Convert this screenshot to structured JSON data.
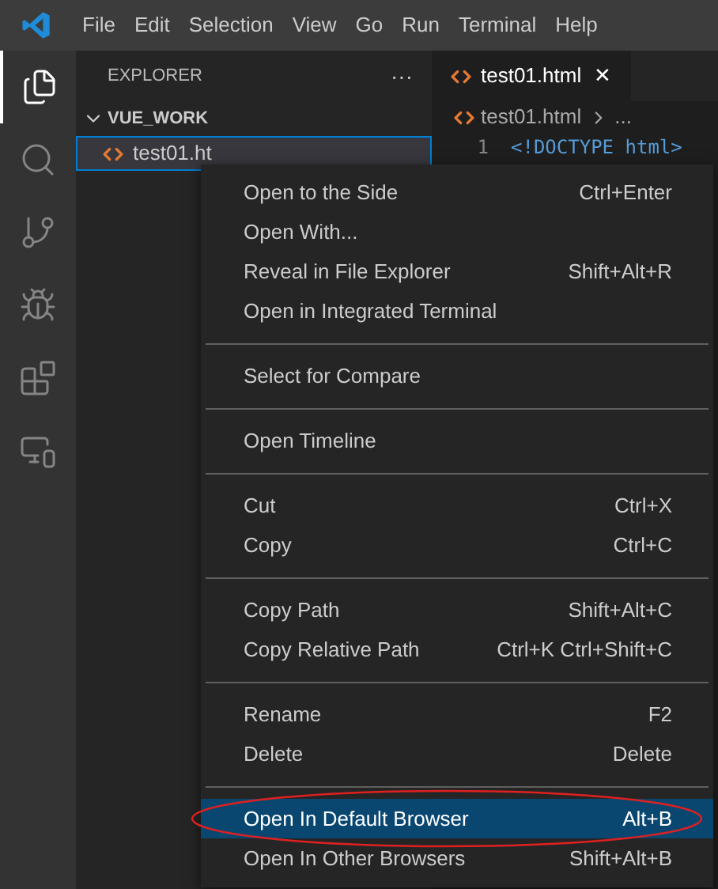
{
  "menu_bar": {
    "items": [
      "File",
      "Edit",
      "Selection",
      "View",
      "Go",
      "Run",
      "Terminal",
      "Help"
    ]
  },
  "activity_bar": {
    "items": [
      {
        "kind": "files",
        "selected": true
      },
      {
        "kind": "search",
        "selected": false
      },
      {
        "kind": "git",
        "selected": false
      },
      {
        "kind": "debug",
        "selected": false
      },
      {
        "kind": "extensions",
        "selected": false
      },
      {
        "kind": "remote",
        "selected": false
      }
    ]
  },
  "sidebar": {
    "title": "EXPLORER",
    "more": "···",
    "folder": {
      "name": "VUE_WORK",
      "expanded": true,
      "children": [
        {
          "name": "test01.ht",
          "selected": true
        }
      ]
    }
  },
  "editor": {
    "tabs": [
      {
        "label": "test01.html",
        "close": "✕",
        "selected": true
      }
    ],
    "breadcrumb": [
      "test01.html",
      "..."
    ],
    "line_number": "1",
    "code": "<!DOCTYPE html>"
  },
  "context_menu": {
    "groups": [
      [
        {
          "label": "Open to the Side",
          "shortcut": "Ctrl+Enter",
          "selected": false,
          "circled": false
        },
        {
          "label": "Open With...",
          "selected": false,
          "circled": false
        },
        {
          "label": "Reveal in File Explorer",
          "shortcut": "Shift+Alt+R",
          "selected": false,
          "circled": false
        },
        {
          "label": "Open in Integrated Terminal",
          "selected": false,
          "circled": false
        }
      ],
      [
        {
          "label": "Select for Compare",
          "selected": false,
          "circled": false
        }
      ],
      [
        {
          "label": "Open Timeline",
          "selected": false,
          "circled": false
        }
      ],
      [
        {
          "label": "Cut",
          "shortcut": "Ctrl+X",
          "selected": false,
          "circled": false
        },
        {
          "label": "Copy",
          "shortcut": "Ctrl+C",
          "selected": false,
          "circled": false
        }
      ],
      [
        {
          "label": "Copy Path",
          "shortcut": "Shift+Alt+C",
          "selected": false,
          "circled": false
        },
        {
          "label": "Copy Relative Path",
          "shortcut": "Ctrl+K Ctrl+Shift+C",
          "selected": false,
          "circled": false
        }
      ],
      [
        {
          "label": "Rename",
          "shortcut": "F2",
          "selected": false,
          "circled": false
        },
        {
          "label": "Delete",
          "shortcut": "Delete",
          "selected": false,
          "circled": false
        }
      ],
      [
        {
          "label": "Open In Default Browser",
          "shortcut": "Alt+B",
          "selected": true,
          "circled": true
        },
        {
          "label": "Open In Other Browsers",
          "shortcut": "Shift+Alt+B",
          "selected": false,
          "circled": false
        }
      ]
    ]
  }
}
